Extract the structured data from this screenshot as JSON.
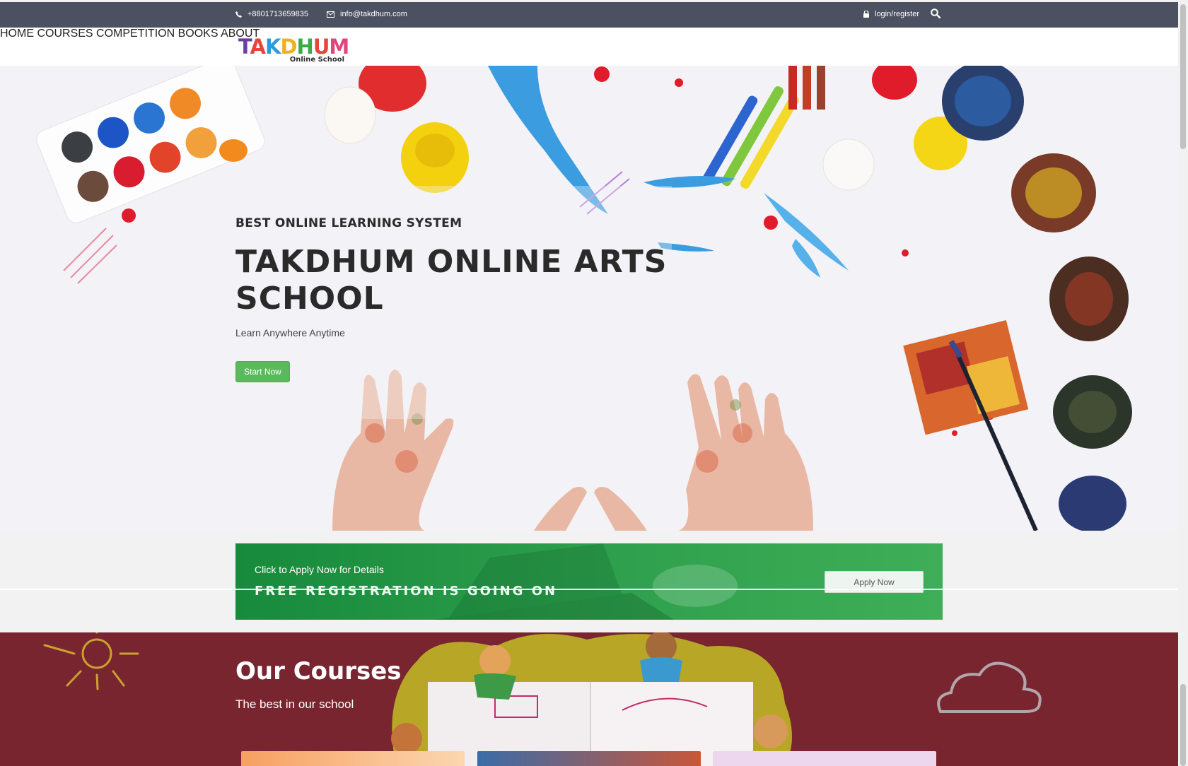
{
  "topbar": {
    "phone": "+8801713659835",
    "email": "info@takdhum.com",
    "login": "login/register",
    "phone_icon": "phone-icon",
    "email_icon": "envelope-icon",
    "lock_icon": "lock-icon",
    "search_icon": "search-icon"
  },
  "header": {
    "logo_text": "TAKDHUM",
    "logo_sub": "Online School",
    "nav": [
      "HOME",
      "COURSES",
      "COMPETITION",
      "BOOKS",
      "ABOUT"
    ]
  },
  "hero": {
    "pretitle": "BEST ONLINE LEARNING SYSTEM",
    "title": "TAKDHUM ONLINE ARTS SCHOOL",
    "tagline": "Learn Anywhere Anytime",
    "button": "Start Now",
    "button_color": "#5cb85c"
  },
  "registration": {
    "small": "Click to Apply Now for Details",
    "big": "FREE REGISTRATION IS GOING ON",
    "button": "Apply Now",
    "color": "#2fa04d"
  },
  "courses": {
    "title": "Our Courses",
    "subtitle": "The best in our school",
    "background": "#782530"
  }
}
